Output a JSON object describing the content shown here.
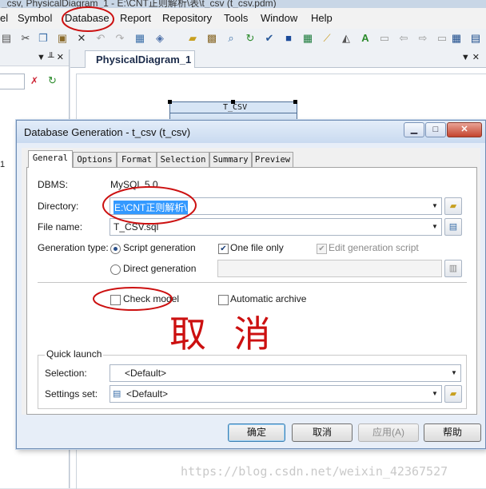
{
  "window": {
    "title_fragment": "_csv, PhysicalDiagram_1 - E:\\CNT正则解析\\表\\t_csv (t_csv.pdm)"
  },
  "menubar": {
    "items": [
      "el",
      "Symbol",
      "Database",
      "Report",
      "Repository",
      "Tools",
      "Window",
      "Help"
    ]
  },
  "toolbar": {
    "icons": [
      "print-icon",
      "cut-icon",
      "copy-icon",
      "paste-icon",
      "delete-icon",
      "undo-icon",
      "redo-icon",
      "properties-icon",
      "model-icon",
      "open-folder-icon",
      "package-icon",
      "find-icon",
      "refresh-icon",
      "check-model-icon",
      "window-icon",
      "table-icon",
      "brush-icon",
      "paint-icon",
      "text-icon",
      "export-icon",
      "back-icon",
      "forward-icon",
      "report-icon",
      "grid-icon",
      "tree-icon"
    ]
  },
  "left_panel": {
    "pin": "▼ ╨ ✕",
    "side_label": "1"
  },
  "diagram": {
    "tab_label": "PhysicalDiagram_1",
    "table_title": "T_CSV"
  },
  "dialog": {
    "title": "Database Generation - t_csv (t_csv)",
    "tabs": [
      "General",
      "Options",
      "Format",
      "Selection",
      "Summary",
      "Preview"
    ],
    "active_tab": "General",
    "dbms_label": "DBMS:",
    "dbms_value": "MySQL 5.0",
    "directory_label": "Directory:",
    "directory_value": "E:\\CNT正则解析\\",
    "filename_label": "File name:",
    "filename_value": "T_CSV.sql",
    "generation_type_label": "Generation type:",
    "script_generation": "Script generation",
    "direct_generation": "Direct generation",
    "one_file_only": "One file only",
    "edit_generation_script": "Edit generation script",
    "check_model": "Check model",
    "automatic_archive": "Automatic archive",
    "quick_launch_title": "Quick launch",
    "selection_label": "Selection:",
    "selection_value": "<Default>",
    "settings_label": "Settings set:",
    "settings_value": "<Default>",
    "buttons": {
      "ok": "确定",
      "cancel": "取消",
      "apply": "应用(A)",
      "help": "帮助"
    }
  },
  "annotation": {
    "handwritten_text": "取 消"
  },
  "watermark": "https://blog.csdn.net/weixin_42367527",
  "colors": {
    "annotation_red": "#cc1010",
    "selection_blue": "#3399ff"
  }
}
